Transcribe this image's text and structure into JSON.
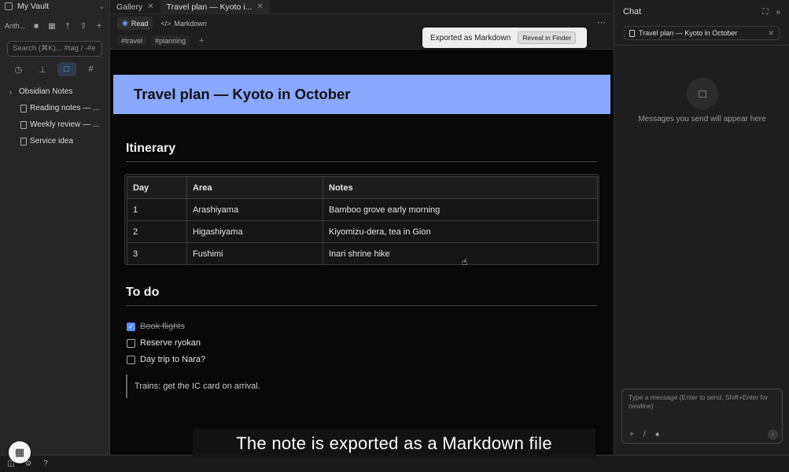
{
  "sidebar": {
    "vault_name": "My Vault",
    "provider_label": "Anth...",
    "search_placeholder": "Search (⌘K)... #tag / -#e",
    "tree": {
      "folder": "Obsidian Notes",
      "files": [
        "Reading notes — ...",
        "Weekly review — ...",
        "Service idea"
      ]
    }
  },
  "tabs": [
    {
      "label": "Gallery"
    },
    {
      "label": "Travel plan — Kyoto i..."
    }
  ],
  "view": {
    "read_label": "Read",
    "markdown_label": "Markdown",
    "tags": [
      "travel",
      "planning"
    ],
    "tag_add": "+"
  },
  "toast": {
    "message": "Exported as Markdown",
    "button": "Reveal in Finder"
  },
  "note": {
    "title": "Travel plan — Kyoto in October",
    "itinerary_heading": "Itinerary",
    "table": {
      "headers": [
        "Day",
        "Area",
        "Notes"
      ],
      "rows": [
        [
          "1",
          "Arashiyama",
          "Bamboo grove early morning"
        ],
        [
          "2",
          "Higashiyama",
          "Kiyomizu-dera, tea in Gion"
        ],
        [
          "3",
          "Fushimi",
          "Inari shrine hike"
        ]
      ]
    },
    "todo_heading": "To do",
    "todos": [
      {
        "label": "Book flights",
        "checked": true
      },
      {
        "label": "Reserve ryokan",
        "checked": false
      },
      {
        "label": "Day trip to Nara?",
        "checked": false
      }
    ],
    "quote": "Trains: get the IC card on arrival."
  },
  "chat": {
    "title": "Chat",
    "context_file": "Travel plan — Kyoto in October",
    "empty_message": "Messages you send will appear here",
    "input_placeholder": "Type a message (Enter to send, Shift+Enter for newline)"
  },
  "caption": "The note is exported as a Markdown file",
  "colors": {
    "accent": "#5b8cff",
    "title_banner": "#8aa8ff"
  }
}
